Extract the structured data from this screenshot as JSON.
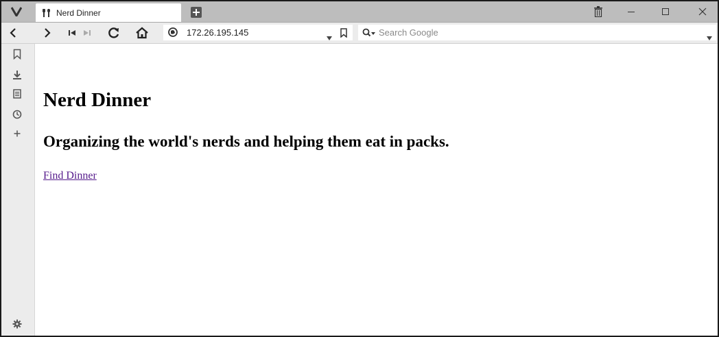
{
  "tab": {
    "title": "Nerd Dinner",
    "favicon": "fork-knife-icon"
  },
  "address": {
    "url": "172.26.195.145"
  },
  "search": {
    "placeholder": "Search Google"
  },
  "page": {
    "heading": "Nerd Dinner",
    "tagline": "Organizing the world's nerds and helping them eat in packs.",
    "link": "Find Dinner"
  },
  "colors": {
    "link_visited": "#551a8b",
    "tabbar_bg": "#bdbdbd",
    "toolbar_bg": "#ececec"
  }
}
